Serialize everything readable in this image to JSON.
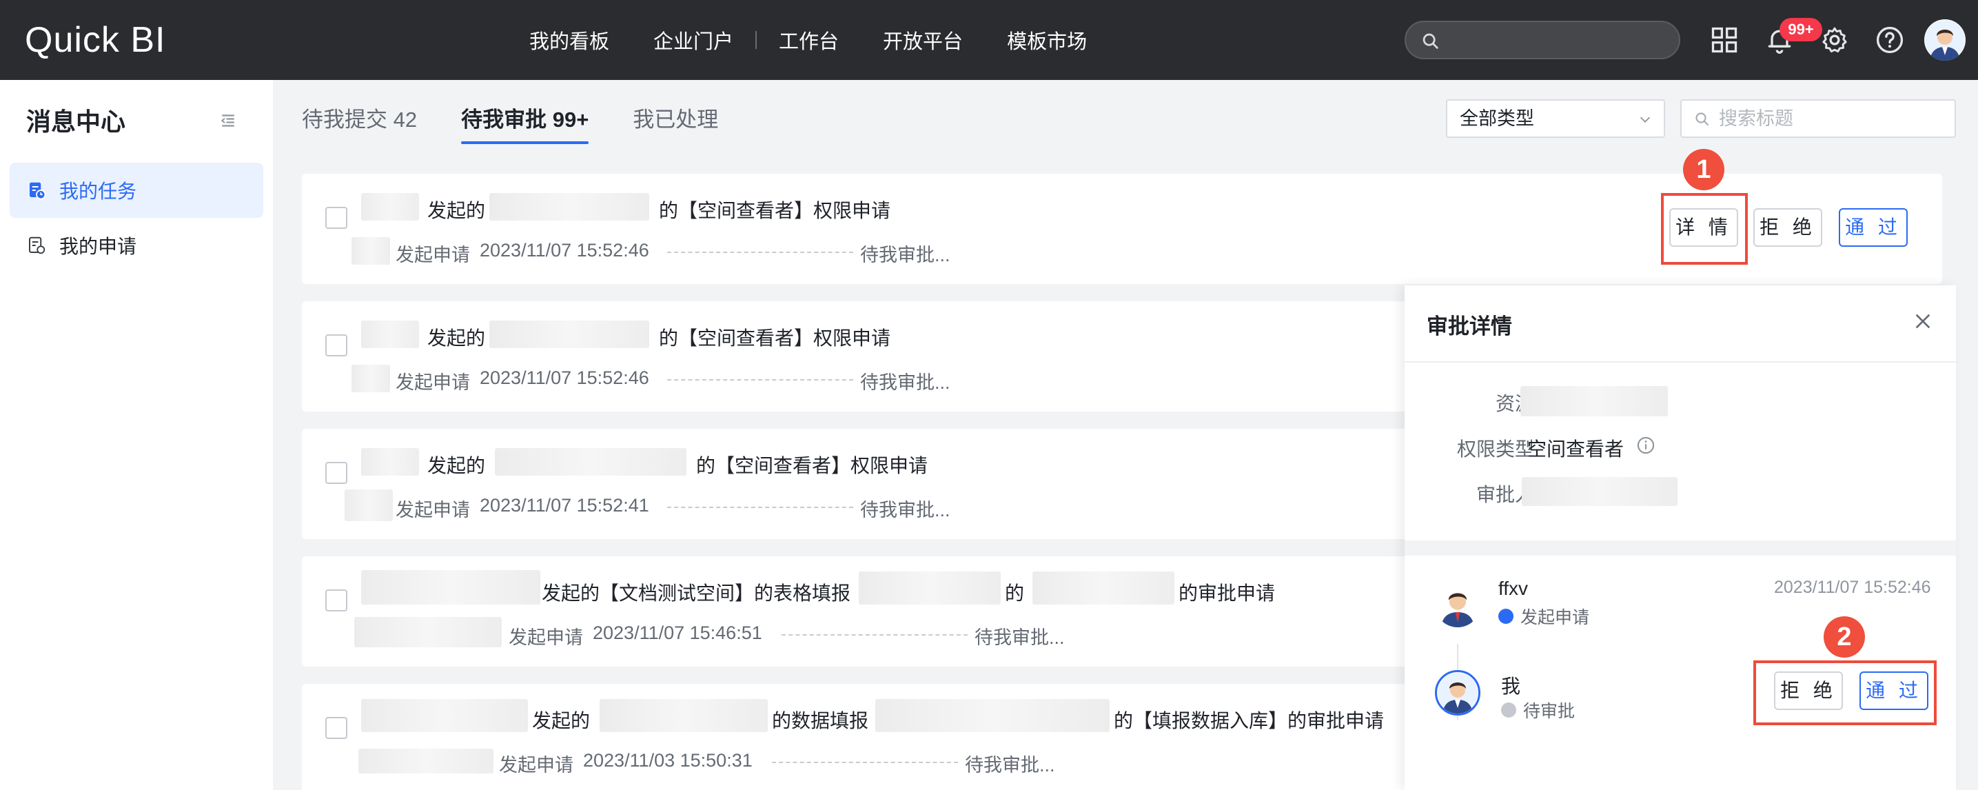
{
  "app": {
    "logo": "Quick BI"
  },
  "topnav": {
    "items": [
      "我的看板",
      "企业门户",
      "工作台",
      "开放平台",
      "模板市场"
    ],
    "search_placeholder": "",
    "notification_badge": "99+"
  },
  "sidebar": {
    "title": "消息中心",
    "items": [
      {
        "label": "我的任务",
        "icon": "task-icon",
        "active": true
      },
      {
        "label": "我的申请",
        "icon": "application-icon",
        "active": false
      }
    ]
  },
  "tabs": [
    {
      "label": "待我提交 42",
      "active": false
    },
    {
      "label": "待我审批 99+",
      "active": true
    },
    {
      "label": "我已处理",
      "active": false
    }
  ],
  "filters": {
    "type_select_value": "全部类型",
    "title_search_placeholder": "搜索标题"
  },
  "tasks": [
    {
      "initiated": "发起的",
      "title_suffix": "的【空间查看者】权限申请",
      "action": "发起申请",
      "time": "2023/11/07 15:52:46",
      "status": "待我审批..."
    },
    {
      "initiated": "发起的",
      "title_suffix": "的【空间查看者】权限申请",
      "action": "发起申请",
      "time": "2023/11/07 15:52:46",
      "status": "待我审批..."
    },
    {
      "initiated": "发起的",
      "title_suffix": "的【空间查看者】权限申请",
      "action": "发起申请",
      "time": "2023/11/07 15:52:41",
      "status": "待我审批..."
    },
    {
      "initiated": "发起的【文档测试空间】的表格填报",
      "mid": "的",
      "title_suffix": "的审批申请",
      "action": "发起申请",
      "time": "2023/11/07 15:46:51",
      "status": "待我审批..."
    },
    {
      "initiated": "发起的",
      "mid": "的数据填报",
      "title_suffix": "的【填报数据入库】的审批申请",
      "action": "发起申请",
      "time": "2023/11/03 15:50:31",
      "status": "待我审批..."
    }
  ],
  "row_actions": {
    "detail": "详 情",
    "reject": "拒 绝",
    "approve": "通 过"
  },
  "steps": [
    "1",
    "2"
  ],
  "detail_panel": {
    "title": "审批详情",
    "fields": [
      {
        "label": "资源",
        "value": ""
      },
      {
        "label": "权限类型",
        "value": "空间查看者"
      },
      {
        "label": "审批人",
        "value": ""
      }
    ],
    "timeline": [
      {
        "name": "ffxv",
        "status": "发起申请",
        "time": "2023/11/07 15:52:46"
      },
      {
        "name": "我",
        "status": "待审批",
        "time": ""
      }
    ],
    "reject_label": "拒 绝",
    "approve_label": "通 过"
  },
  "colors": {
    "accent": "#2b6bf3",
    "topbar": "#2b2c2f",
    "highlight": "#ee4b3b",
    "badge": "#f5384a"
  }
}
